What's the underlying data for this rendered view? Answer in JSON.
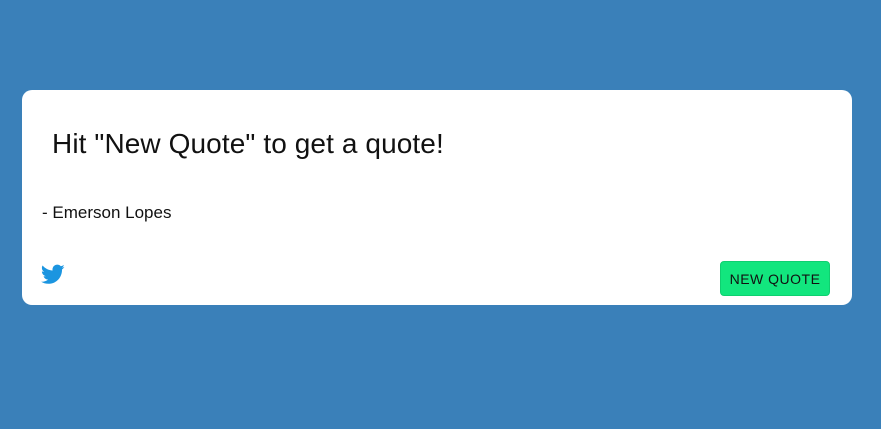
{
  "quote": {
    "text": "Hit \"New Quote\" to get a quote!",
    "author": "- Emerson Lopes"
  },
  "actions": {
    "tweet_icon": "twitter-icon",
    "new_quote_label": "NEW QUOTE"
  },
  "colors": {
    "background": "#3a80b9",
    "card": "#ffffff",
    "button": "#12e67e",
    "twitter": "#1b95e0"
  }
}
